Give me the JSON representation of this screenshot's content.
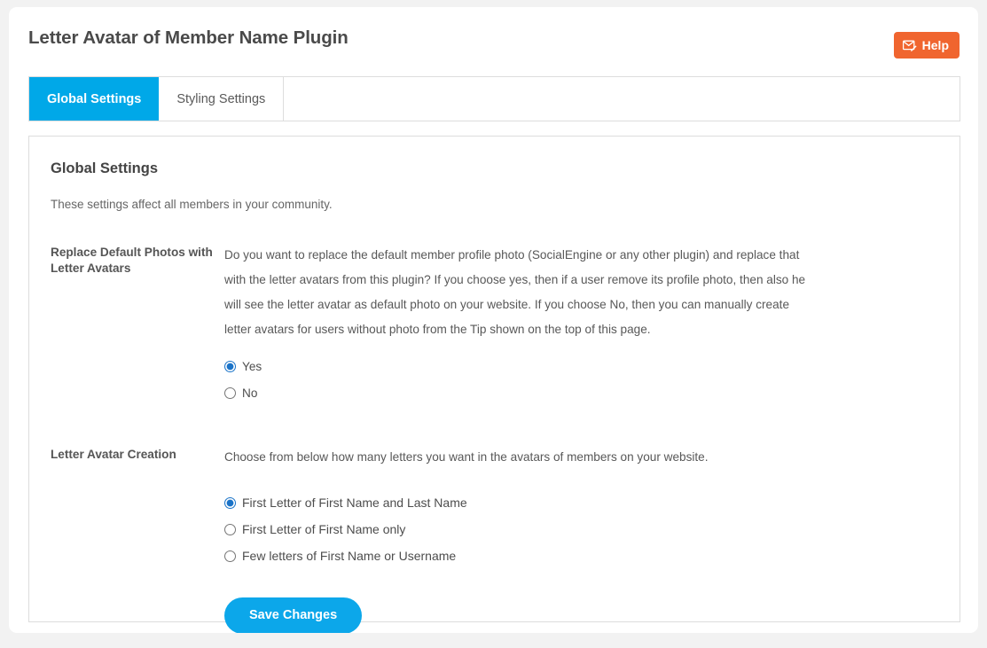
{
  "header": {
    "title": "Letter Avatar of Member Name Plugin",
    "help_label": "Help",
    "help_icon": "envelope-pencil-icon",
    "help_color": "#f0652f"
  },
  "tabs": [
    {
      "label": "Global Settings",
      "active": true
    },
    {
      "label": "Styling Settings",
      "active": false
    }
  ],
  "panel": {
    "title": "Global Settings",
    "subtitle": "These settings affect all members in your community.",
    "accent_color": "#00a8e8"
  },
  "settings": [
    {
      "label": "Replace Default Photos with Letter Avatars",
      "description": "Do you want to replace the default member profile photo (SocialEngine or any other plugin) and replace that with the letter avatars from this plugin? If you choose yes, then if a user remove its profile photo, then also he will see the letter avatar as default photo on your website. If you choose No, then you can manually create letter avatars for users without photo from the Tip shown on the top of this page.",
      "options": [
        {
          "label": "Yes",
          "selected": true
        },
        {
          "label": "No",
          "selected": false
        }
      ]
    },
    {
      "label": "Letter Avatar Creation",
      "description": "Choose from below how many letters you want in the avatars of members on your website.",
      "options": [
        {
          "label": "First Letter of First Name and Last Name",
          "selected": true
        },
        {
          "label": "First Letter of First Name only",
          "selected": false
        },
        {
          "label": "Few letters of First Name or Username",
          "selected": false
        }
      ]
    }
  ],
  "actions": {
    "save_label": "Save Changes",
    "save_color": "#0ca7ea"
  }
}
